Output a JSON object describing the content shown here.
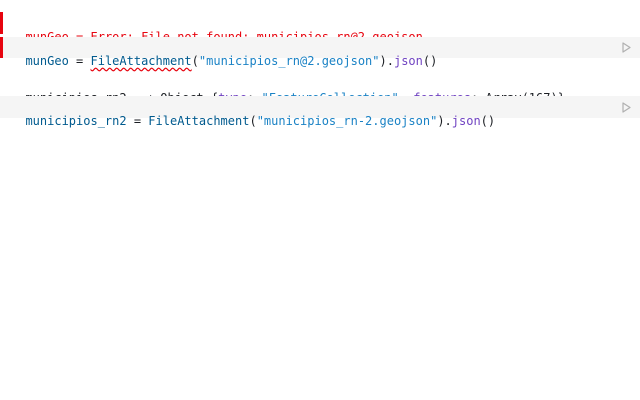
{
  "cells": [
    {
      "output": {
        "name": "munGeo",
        "eq": " = ",
        "error_text": "Error: File not found: municipios_rn@2.geojson"
      },
      "code": {
        "name": "munGeo",
        "eq": " = ",
        "fn": "FileAttachment",
        "open": "(",
        "arg": "\"municipios_rn@2.geojson\"",
        "close_dot": ").",
        "method": "json",
        "call": "()"
      },
      "status": "error"
    },
    {
      "output": {
        "name": "municipios_rn2",
        "eq": " = ",
        "object_label": "Object ",
        "brace_open": "{",
        "key1": "type",
        "colon1": ": ",
        "val1": "\"FeatureCollection\"",
        "comma": ", ",
        "key2": "features",
        "colon2": ": ",
        "val2": "Array(167)",
        "brace_close": "}"
      },
      "code": {
        "name": "municipios_rn2",
        "eq": " = ",
        "fn": "FileAttachment",
        "open": "(",
        "arg": "\"municipios_rn-2.geojson\"",
        "close_dot": ").",
        "method": "json",
        "call": "()"
      },
      "status": "ok"
    }
  ],
  "colors": {
    "error": "#e7040f",
    "code_bg": "#f5f5f5",
    "string": "#1a82c5",
    "variable": "#005a8e",
    "property": "#6f42c1"
  },
  "icons": {
    "run": "play-outline-icon",
    "expand": "disclosure-triangle-icon"
  }
}
